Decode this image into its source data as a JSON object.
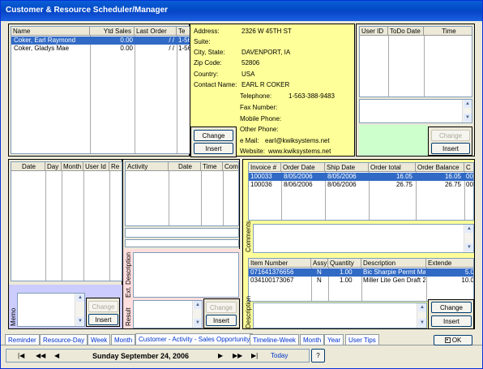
{
  "title": "Customer & Resource Scheduler/Manager",
  "customers": {
    "headers": [
      "Name",
      "Ytd Sales",
      "Last Order",
      "Te"
    ],
    "rows": [
      {
        "name": "Coker, Earl Raymond",
        "ytd": "0.00",
        "last": "/ /",
        "te": "1-56"
      },
      {
        "name": "Coker, Gladys Mae",
        "ytd": "0.00",
        "last": "/ /",
        "te": "1-56"
      }
    ]
  },
  "address": {
    "labels": {
      "address": "Address:",
      "suite": "Suite:",
      "city": "City, State:",
      "zip": "Zip Code:",
      "country": "Country:",
      "contact": "Contact Name:",
      "telephone": "Telephone:",
      "fax": "Fax Number:",
      "mobile": "Mobile Phone:",
      "other": "Other Phone:",
      "email": "e Mail:",
      "website": "Website:"
    },
    "values": {
      "address": "2326 W 45TH ST",
      "city": "DAVENPORT, IA",
      "zip": "52806",
      "country": "USA",
      "contact": "EARL R COKER",
      "telephone": "1-563-388-9483",
      "email": "earl@kwiksystems.net",
      "website": "www.kwiksystems.net"
    },
    "change": "Change",
    "insert": "Insert"
  },
  "todo": {
    "headers": [
      "User ID",
      "ToDo Date",
      "Time"
    ],
    "change": "Change",
    "insert": "Insert"
  },
  "reminders": {
    "headers": [
      "Date",
      "Day",
      "Month",
      "User Id",
      "Re"
    ],
    "memo": "Memo",
    "change": "Change",
    "insert": "Insert"
  },
  "activity": {
    "headers": [
      "Activity",
      "Date",
      "Time",
      "Com"
    ],
    "ext": "Ext. Description",
    "result": "Result",
    "change": "Change",
    "insert": "Insert"
  },
  "invoices": {
    "headers": [
      "Invoice #",
      "Order Date",
      "Ship Date",
      "Order total",
      "Order Balance",
      "C"
    ],
    "rows": [
      {
        "inv": "100033",
        "od": "8/05/2006",
        "sd": "8/05/2006",
        "tot": "16.05",
        "bal": "16.05",
        "c": "00"
      },
      {
        "inv": "100036",
        "od": "8/06/2006",
        "sd": "8/06/2006",
        "tot": "26.75",
        "bal": "26.75",
        "c": "00"
      }
    ],
    "comments": "Comments"
  },
  "items": {
    "headers": [
      "Item Number",
      "Assy",
      "Quantity",
      "Description",
      "Extende"
    ],
    "rows": [
      {
        "num": "071641376656",
        "assy": "N",
        "qty": "1.00",
        "desc": "Bic Sharpie Permt Marker 5(",
        "ext": "5.0"
      },
      {
        "num": "034100173067",
        "assy": "N",
        "qty": "1.00",
        "desc": "Miller Lite Gen Draft 24/12o",
        "ext": "10.0"
      }
    ],
    "description": "Description",
    "change": "Change",
    "insert": "Insert"
  },
  "tabs": [
    "Reminder",
    "Resource-Day",
    "Week",
    "Month",
    "Customer - Activity - Sales Opportunity",
    "Timeline-Week",
    "Month",
    "Year",
    "User Tips"
  ],
  "ok": "OK",
  "nav": {
    "date": "Sunday September 24, 2006",
    "today": "Today"
  }
}
